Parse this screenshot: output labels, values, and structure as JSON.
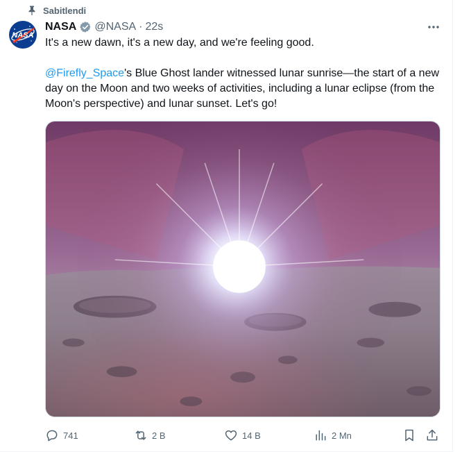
{
  "pinned": {
    "label": "Sabitlendi",
    "icon": "pin-icon"
  },
  "author": {
    "name": "NASA",
    "handle": "@NASA",
    "separator": "·",
    "time": "22s",
    "avatar_text": "NASA",
    "verified_icon": "verified-badge-icon"
  },
  "tweet": {
    "line1": "It's a new dawn, it's a new day, and we're feeling good.",
    "mention": "@Firefly_Space",
    "line2_rest": "'s Blue Ghost lander witnessed lunar sunrise—the start of a new day on the Moon and two weeks of activities, including a lunar eclipse (from the Moon's perspective) and lunar sunset. Let's go!"
  },
  "actions": {
    "replies": "741",
    "reposts": "2 B",
    "likes": "14 B",
    "views": "2 Mn"
  },
  "colors": {
    "accent": "#1d9bf0",
    "secondary_text": "#536471",
    "nasa_blue": "#0b3d91",
    "nasa_red": "#fc3d21"
  }
}
